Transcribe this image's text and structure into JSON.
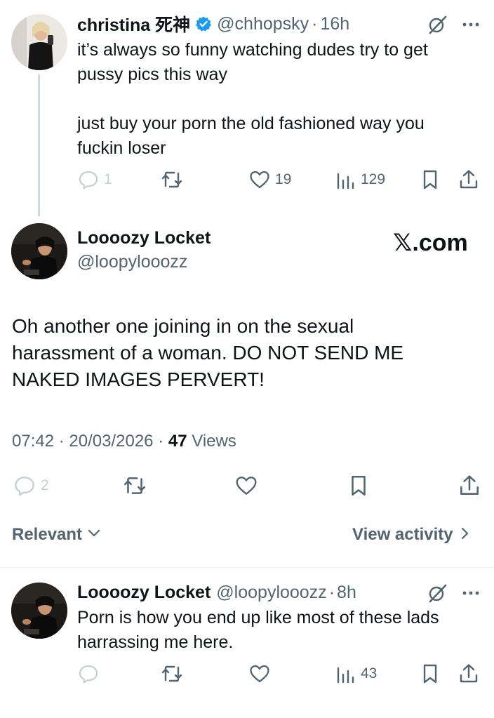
{
  "reply1": {
    "name": "christina 死神",
    "handle": "@chhopsky",
    "time": "16h",
    "lines": [
      "it’s always so funny watching dudes try to get",
      "pussy pics this way",
      "just buy your porn the old fashioned way you",
      "fuckin loser"
    ],
    "replies": "1",
    "likes": "19",
    "views": "129"
  },
  "main": {
    "name": "Loooozy Locket",
    "handle": "@loopylooozz",
    "watermark": "𝕏.com",
    "lines": [
      "Oh another one joining in on the sexual",
      "harassment of a woman. DO NOT SEND ME",
      "NAKED IMAGES PERVERT!"
    ],
    "time": "07:42",
    "date": "20/03/2026",
    "views_count": "47",
    "views_label": "Views",
    "replies": "2"
  },
  "sort": {
    "label": "Relevant",
    "view_activity": "View activity"
  },
  "reply2": {
    "name": "Loooozy Locket",
    "handle": "@loopylooozz",
    "time": "8h",
    "lines": [
      "Porn is how you end up like most of these lads",
      "harrassing me here."
    ],
    "views": "43"
  },
  "colors": {
    "text": "#0f1419",
    "muted": "#536471",
    "verified": "#1d9bf0",
    "divider": "#eff3f4"
  }
}
